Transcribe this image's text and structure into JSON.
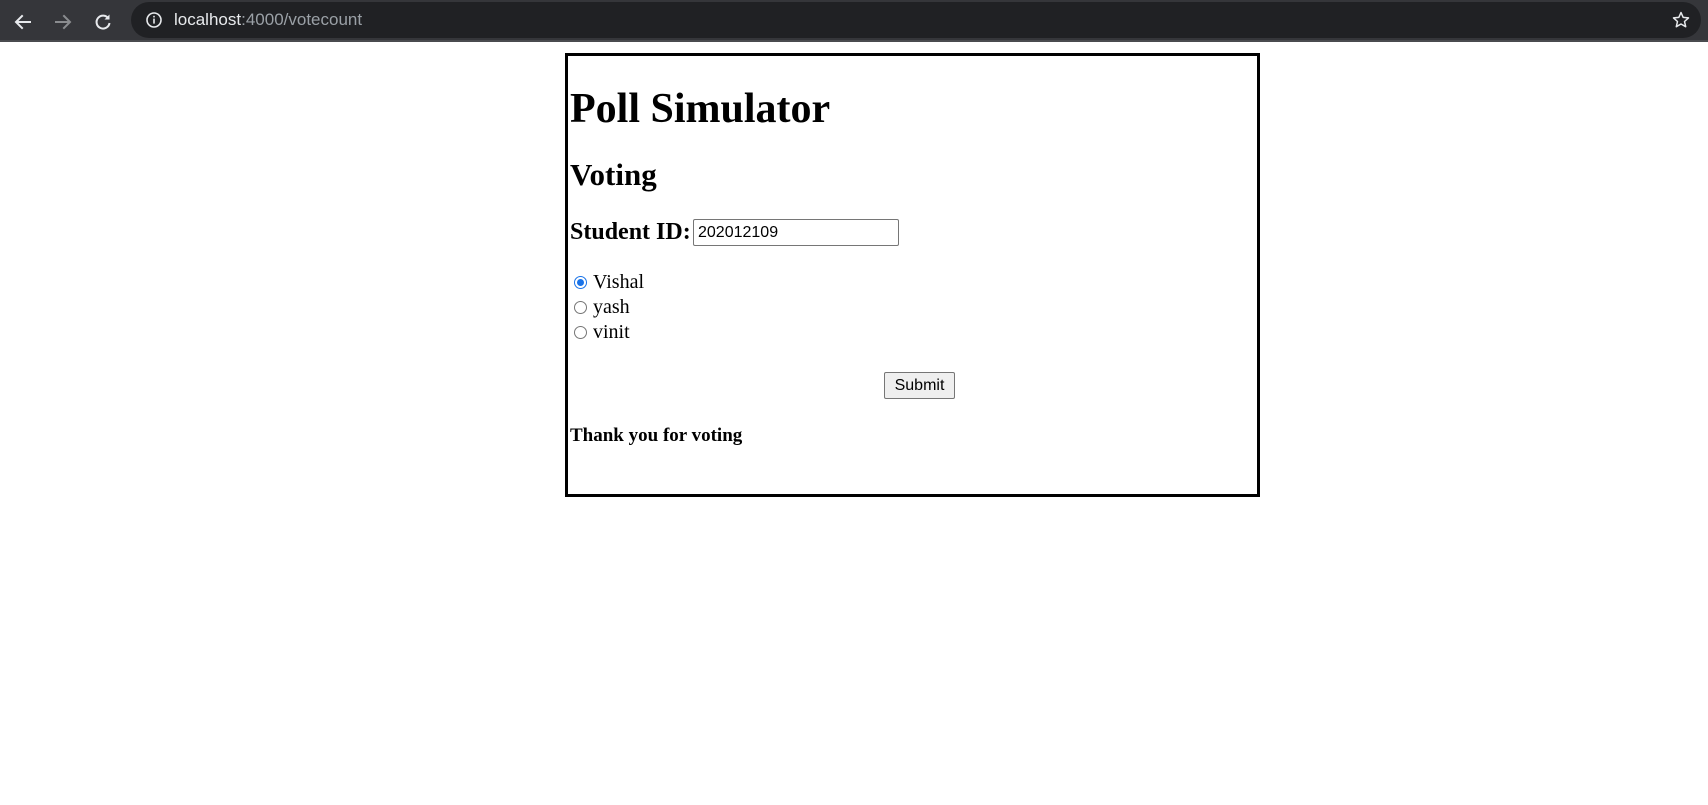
{
  "browser": {
    "url_host": "localhost",
    "url_path": ":4000/votecount",
    "icons": [
      "back-arrow-icon",
      "forward-arrow-icon",
      "reload-icon",
      "info-icon",
      "bookmark-star-icon"
    ],
    "colors": {
      "toolbar": "#35363a",
      "omnibox": "#202124",
      "url_host": "#e8eaed",
      "url_path": "#9aa0a6"
    }
  },
  "page": {
    "title": "Poll Simulator",
    "subtitle": "Voting",
    "student_id_label": "Student ID:",
    "student_id_value": "202012109",
    "options": [
      {
        "label": "Vishal",
        "checked": true
      },
      {
        "label": "yash",
        "checked": false
      },
      {
        "label": "vinit",
        "checked": false
      }
    ],
    "submit_label": "Submit",
    "thanks_message": "Thank you for voting",
    "colors": {
      "radio_checked": "#1a73e8",
      "border": "#000000"
    }
  }
}
